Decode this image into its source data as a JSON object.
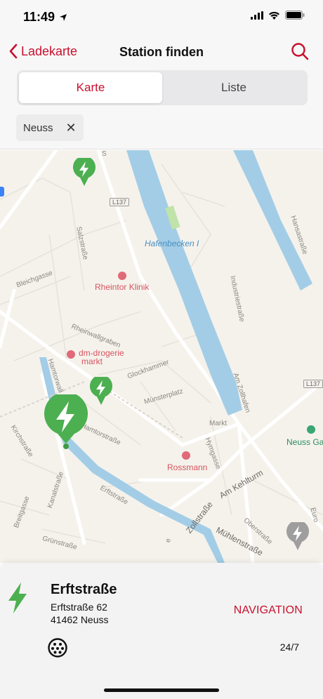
{
  "status_bar": {
    "time": "11:49",
    "location_icon": "location-arrow-icon",
    "icons": [
      "cellular-signal-icon",
      "wifi-icon",
      "battery-icon"
    ]
  },
  "nav": {
    "back_label": "Ladekarte",
    "title": "Station finden",
    "search_icon": "search-icon"
  },
  "segments": [
    {
      "label": "Karte",
      "active": true
    },
    {
      "label": "Liste",
      "active": false
    }
  ],
  "filter_chip": {
    "label": "Neuss",
    "clear_glyph": "✕"
  },
  "map": {
    "road_shields": [
      "L137",
      "L137"
    ],
    "water_label": "Hafenbecken I",
    "pois": {
      "clinic": "Rheintor Klinik",
      "drugstore_1": "dm-drogerie",
      "drugstore_2": "markt",
      "rossmann": "Rossmann",
      "neuss_gal": "Neuss Gal"
    },
    "streets": {
      "salz": "Salzstraße",
      "bleich": "Bleichgasse",
      "rheinwall": "Rheinwallgraben",
      "glock": "Glockhammer",
      "muenster": "Münsterplatz",
      "hamtor": "Hamtorwall",
      "hamtorstr": "Hamtorstraße",
      "kirch": "Kirchstraße",
      "markt": "Markt",
      "hym": "Hymgasse",
      "kehlturm": "Am Kehlturm",
      "zoll": "Zollstraße",
      "erft": "Erftstraße",
      "kanal": "Kanalstraße",
      "breit": "Breitgasse",
      "gruen": "Grünstraße",
      "muehlen": "Mühlenstraße",
      "ober": "Oberstraße",
      "industrie": "Industriestraße",
      "zollhafen": "Am Zollhafen",
      "hansa": "Hansastraße",
      "euro": "Euro",
      "stub": "S",
      "stub2": "e"
    },
    "markers": [
      {
        "name": "charging-marker-north",
        "state": "available"
      },
      {
        "name": "charging-marker-glockhammer",
        "state": "available"
      },
      {
        "name": "charging-marker-selected",
        "state": "selected"
      },
      {
        "name": "charging-marker-east",
        "state": "unavailable"
      }
    ]
  },
  "station": {
    "name": "Erftstraße",
    "street": "Erftstraße 62",
    "city": "41462 Neuss",
    "navigation_label": "NAVIGATION",
    "connector_icon": "type2-plug-icon",
    "hours": "24/7"
  },
  "colors": {
    "accent": "#c8102e",
    "marker_green": "#4caf50",
    "marker_gray": "#9e9e9e",
    "water": "#a3cde6"
  }
}
